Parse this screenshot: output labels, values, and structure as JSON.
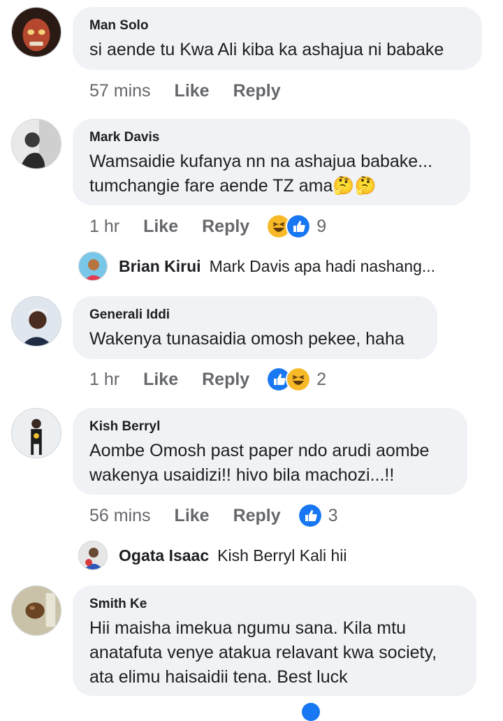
{
  "comments": [
    {
      "author": "Man Solo",
      "text": "si aende tu Kwa Ali kiba ka ashajua ni babake",
      "time": "57 mins",
      "like_label": "Like",
      "reply_label": "Reply"
    },
    {
      "author": "Mark Davis",
      "text": "Wamsaidie kufanya nn na ashajua babake...\ntumchangie fare aende TZ ama🤔🤔",
      "time": "1 hr",
      "like_label": "Like",
      "reply_label": "Reply",
      "reaction_count": "9",
      "reactions": [
        "haha-icon",
        "like-icon"
      ]
    },
    {
      "author": "Generali Iddi",
      "text": "Wakenya tunasaidia omosh pekee, haha",
      "time": "1 hr",
      "like_label": "Like",
      "reply_label": "Reply",
      "reaction_count": "2",
      "reactions": [
        "like-icon",
        "haha-icon"
      ]
    },
    {
      "author": "Kish Berryl",
      "text": "Aombe Omosh past paper ndo arudi aombe\nwakenya usaidizi!! hivo bila machozi...!!",
      "time": "56 mins",
      "like_label": "Like",
      "reply_label": "Reply",
      "reaction_count": "3",
      "reactions": [
        "like-icon"
      ]
    },
    {
      "author": "Smith Ke",
      "text": "Hii maisha imekua ngumu sana. Kila mtu\nanatafuta venye atakua relavant kwa society,\nata elimu haisaidii tena. Best luck"
    }
  ],
  "replies": [
    {
      "author": "Brian Kirui",
      "text": "Mark Davis apa hadi nashang..."
    },
    {
      "author": "Ogata Isaac",
      "text": "Kish Berryl Kali hii"
    }
  ],
  "colors": {
    "bubble": "#f0f2f5",
    "meta": "#65676b",
    "like_blue": "#1877f2",
    "haha_yellow": "#f7b928"
  }
}
